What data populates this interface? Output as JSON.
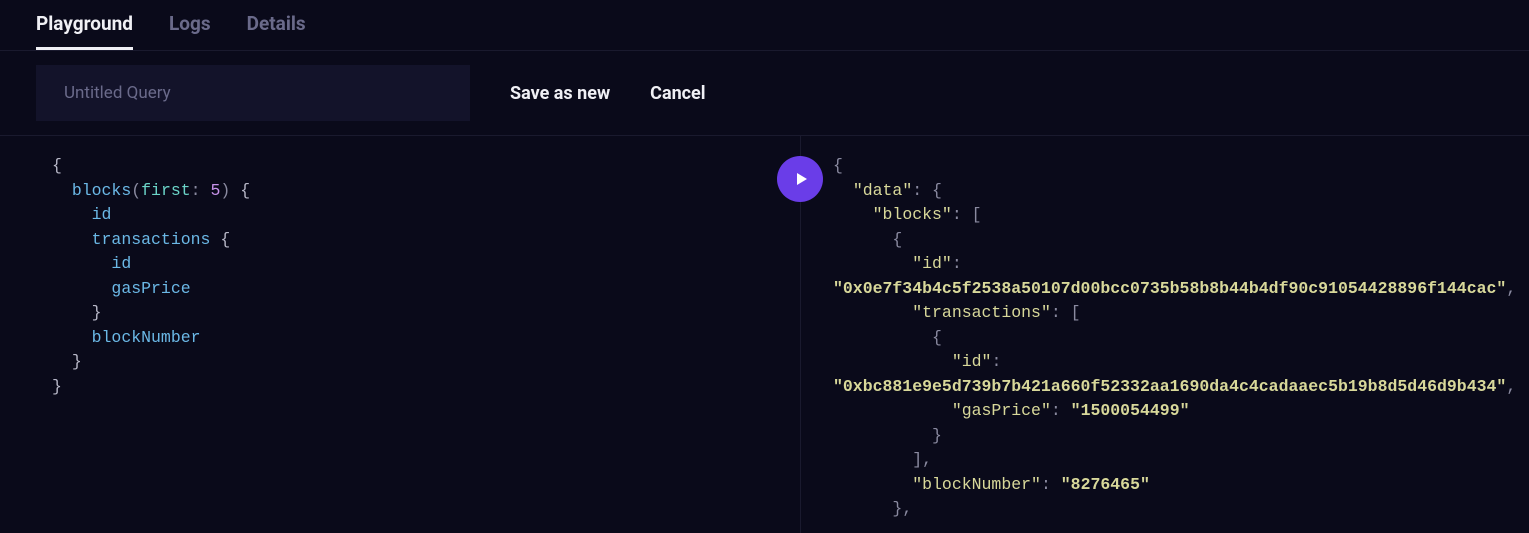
{
  "tabs": {
    "playground": "Playground",
    "logs": "Logs",
    "details": "Details"
  },
  "toolbar": {
    "query_name_placeholder": "Untitled Query",
    "query_name_value": "",
    "save_label": "Save as new",
    "cancel_label": "Cancel"
  },
  "query": {
    "root_field": "blocks",
    "arg_name": "first",
    "arg_value": "5",
    "fields": {
      "id": "id",
      "transactions": "transactions",
      "tx_id": "id",
      "gasPrice": "gasPrice",
      "blockNumber": "blockNumber"
    }
  },
  "result": {
    "data_key": "\"data\"",
    "blocks_key": "\"blocks\"",
    "id_key": "\"id\"",
    "id_value": "\"0x0e7f34b4c5f2538a50107d00bcc0735b58b8b44b4df90c91054428896f144cac\"",
    "transactions_key": "\"transactions\"",
    "tx_id_key": "\"id\"",
    "tx_id_value": "\"0xbc881e9e5d739b7b421a660f52332aa1690da4c4cadaaec5b19b8d5d46d9b434\"",
    "gasPrice_key": "\"gasPrice\"",
    "gasPrice_value": "\"1500054499\"",
    "blockNumber_key": "\"blockNumber\"",
    "blockNumber_value": "\"8276465\""
  }
}
